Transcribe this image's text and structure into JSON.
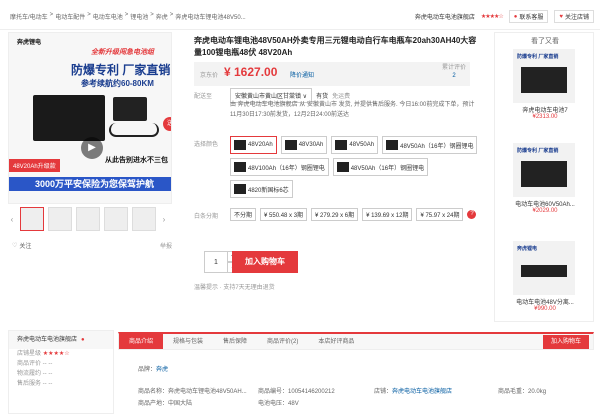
{
  "breadcrumb": [
    "摩托车/电动车",
    ">",
    "电动车配件",
    ">",
    "电动车电池",
    ">",
    "锂电池",
    ">",
    "奔虎",
    ">",
    "奔虎电动车锂电池48V50..."
  ],
  "shop": {
    "name": "奔虎电动车电池旗舰店",
    "stars": "★★★★☆",
    "contact": "联系客服",
    "follow": "关注店铺"
  },
  "gallery": {
    "brand": "奔虎锂电",
    "title1": "全新升级闯急电池组",
    "title2": "防爆专利 厂家直销",
    "title3": "参考续航约60-80KM",
    "send": "送",
    "tag1": "48V20Ah升级款",
    "tag2": "从此告别进水不三包",
    "bluebar": "3000万平安保险为您保驾护航",
    "play": "▶"
  },
  "follow_label": "关注",
  "report_label": "举报",
  "product": {
    "title": "奔虎电动车锂电池48V50AH外卖专用三元锂电动自行车电瓶车20ah30AH40大容量100锂电瓶48伏 48V20Ah"
  },
  "price": {
    "label": "京东价",
    "value": "¥ 1627.00",
    "notice": "降价通知",
    "review_label": "累计评价",
    "review_count": "2"
  },
  "delivery": {
    "label": "配送至",
    "address": "安徽黄山市黄山区甘棠镇 ∨",
    "stock": "有货",
    "free": "免运费",
    "ship_text": "由 奔虎电动车电池旗舰店 从 安徽黄山市 发货, 并提供售后服务. 今日16:00前完成下单，预计11月30日17:30前发货，12月2日24:00前送达"
  },
  "color": {
    "label": "选择颜色",
    "options": [
      "48V20Ah",
      "48V30Ah",
      "48V50Ah",
      "48V50Ah（16年）钢圈锂电",
      "48V100Ah（16年）钢圈锂电",
      "48V50Ah（16年）钢圈锂电",
      "4820新国标6芯"
    ]
  },
  "service": {
    "label": "白条分期",
    "options": [
      "不分期",
      "¥ 550.48 x 3期",
      "¥ 279.29 x 6期",
      "¥ 139.69 x 12期",
      "¥ 75.97 x 24期"
    ]
  },
  "quantity": {
    "value": "1",
    "plus": "+",
    "minus": "-"
  },
  "cart_label": "加入购物车",
  "tips": "温馨提示  · 支持7天无理由退货",
  "side": {
    "title": "看了又看",
    "items": [
      {
        "name": "奔虎电动车电池7",
        "price": "¥2313.00",
        "text": "防爆专利 厂家直销"
      },
      {
        "name": "电动车电池60V50Ah...",
        "price": "¥2029.00",
        "text": "防爆专利 厂家直销"
      },
      {
        "name": "电动车电池48V分离...",
        "price": "¥990.00",
        "text": "奔虎锂电"
      }
    ]
  },
  "shopcard": {
    "name": "奔虎电动车电池旗舰店",
    "rating_label": "店铺星级",
    "rating": "★★★★☆",
    "items": [
      "商品评价 -- --",
      "物流履约 -- --",
      "售后服务 -- --"
    ]
  },
  "tabs": [
    "商品介绍",
    "规格与包装",
    "售后保障",
    "商品评价(2)",
    "本店好评商品"
  ],
  "tab_cart": "加入购物车",
  "brand": {
    "label": "品牌：",
    "value": "奔虎"
  },
  "specs": {
    "name_label": "商品名称：",
    "name": "奔虎电动车锂电池48V50AH...",
    "code_label": "商品编号：",
    "code": "10054146200212",
    "store_label": "店铺：",
    "store": "奔虎电动车电池旗舰店",
    "weight_label": "商品毛重：",
    "weight": "20.0kg",
    "origin_label": "商品产地：",
    "origin": "中国大陆",
    "voltage_label": "电池电压：",
    "voltage": "48V"
  }
}
